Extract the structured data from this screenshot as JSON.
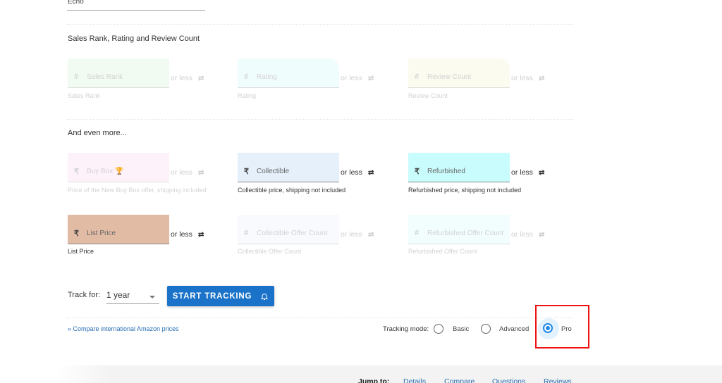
{
  "top_field": {
    "value": "Echo"
  },
  "sections": {
    "sales_rank_title": "Sales Rank, Rating and Review Count",
    "more_title": "And even more..."
  },
  "or_less": "or less",
  "fields": {
    "sales_rank": {
      "icon": "#",
      "placeholder": "Sales Rank",
      "hint": "Sales Rank",
      "bg": "#f1fbf1",
      "enabled": false
    },
    "rating": {
      "icon": "#",
      "placeholder": "Rating",
      "hint": "Rating",
      "bg": "#f0fdfd",
      "enabled": false
    },
    "review_count": {
      "icon": "#",
      "placeholder": "Review Count",
      "hint": "Review Count",
      "bg": "#fbfcef",
      "enabled": false
    },
    "buy_box": {
      "icon": "₹",
      "placeholder": "Buy Box 🏆",
      "hint": "Price of the New Buy Box offer, shipping included",
      "bg": "#fdf2fa",
      "enabled": false
    },
    "collectible": {
      "icon": "₹",
      "placeholder": "Collectible",
      "hint": "Collectible price, shipping not included",
      "bg": "#e5f0fb",
      "enabled": true
    },
    "refurbished": {
      "icon": "₹",
      "placeholder": "Refurbished",
      "hint": "Refurbished price, shipping not included",
      "bg": "#c9fcfd",
      "enabled": true
    },
    "list_price": {
      "icon": "₹",
      "placeholder": "List Price",
      "hint": "List Price",
      "bg": "#e2bba5",
      "enabled": true
    },
    "collectible_offer_count": {
      "icon": "#",
      "placeholder": "Collectible Offer Count",
      "hint": "Collectible Offer Count",
      "bg": "#f8fafe",
      "enabled": false
    },
    "refurbished_offer_count": {
      "icon": "#",
      "placeholder": "Refurbished Offer Count",
      "hint": "Refurbished Offer Count",
      "bg": "#f2fdfe",
      "enabled": false
    }
  },
  "tracking": {
    "track_for_label": "Track for:",
    "duration": "1 year",
    "start_button": "START TRACKING",
    "button_color": "#1a73c8",
    "compare_link": "» Compare international Amazon prices",
    "mode_label": "Tracking mode:",
    "modes": [
      {
        "label": "Basic",
        "selected": false
      },
      {
        "label": "Advanced",
        "selected": false
      },
      {
        "label": "Pro",
        "selected": true
      }
    ]
  },
  "jump": {
    "label": "Jump to:",
    "links": [
      "Details",
      "Compare",
      "Questions",
      "Reviews"
    ]
  }
}
